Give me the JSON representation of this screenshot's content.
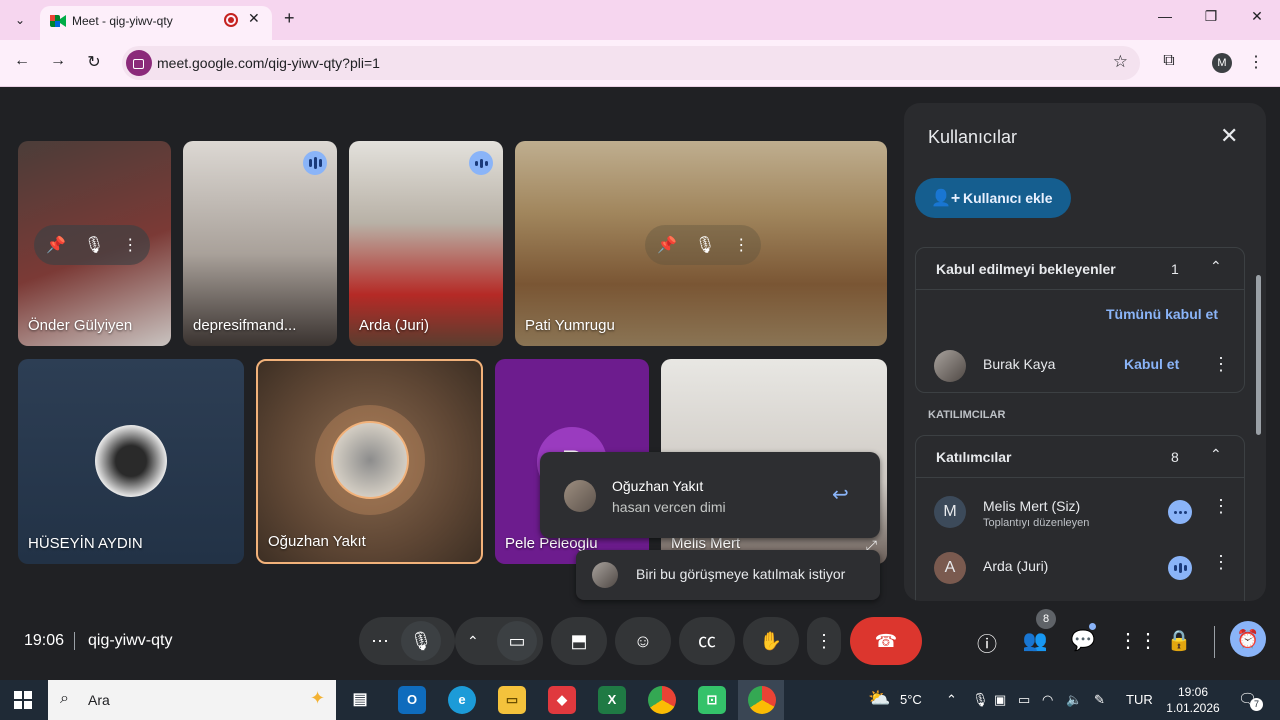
{
  "browser": {
    "tab_title": "Meet - qig-yiwv-qty",
    "tab_close": "✕",
    "new_tab": "+",
    "url": "meet.google.com/qig-yiwv-qty?pli=1",
    "profile_initial": "M",
    "window": {
      "minimize": "—",
      "restore": "❐",
      "close": "✕"
    }
  },
  "tiles": [
    {
      "name": "Önder Gülyiyen"
    },
    {
      "name": "depresifmand..."
    },
    {
      "name": "Arda (Juri)"
    },
    {
      "name": "Pati Yumrugu"
    },
    {
      "name": "HÜSEYİN AYDIN"
    },
    {
      "name": "Oğuzhan Yakıt"
    },
    {
      "name": "Pele Peleoglu",
      "initial": "P"
    },
    {
      "name": "Melis Mert"
    }
  ],
  "toasts": {
    "message": {
      "from": "Oğuzhan Yakıt",
      "text": "hasan vercen dimi"
    },
    "join": {
      "text": "Biri bu görüşmeye katılmak istiyor"
    }
  },
  "panel": {
    "title": "Kullanıcılar",
    "add_button": "Kullanıcı ekle",
    "waiting": {
      "title": "Kabul edilmeyi bekleyenler",
      "count": "1",
      "accept_all": "Tümünü kabul et",
      "people": [
        {
          "name": "Burak Kaya",
          "action": "Kabul et"
        }
      ]
    },
    "participants_subhead": "KATILIMCILAR",
    "participants": {
      "title": "Katılımcılar",
      "count": "8",
      "people": [
        {
          "initial": "M",
          "name": "Melis Mert (Siz)",
          "role": "Toplantıyı düzenleyen",
          "color": "#3c4a5a"
        },
        {
          "initial": "A",
          "name": "Arda (Juri)",
          "role": "",
          "color": "#7a5a4f"
        }
      ]
    }
  },
  "bottom": {
    "time": "19:06",
    "meeting_code": "qig-yiwv-qty",
    "people_badge": "8"
  },
  "taskbar": {
    "search_placeholder": "Ara",
    "weather": "5°C",
    "language": "TUR",
    "time": "19:06",
    "date": "1.01.2026",
    "notifications": "7"
  }
}
